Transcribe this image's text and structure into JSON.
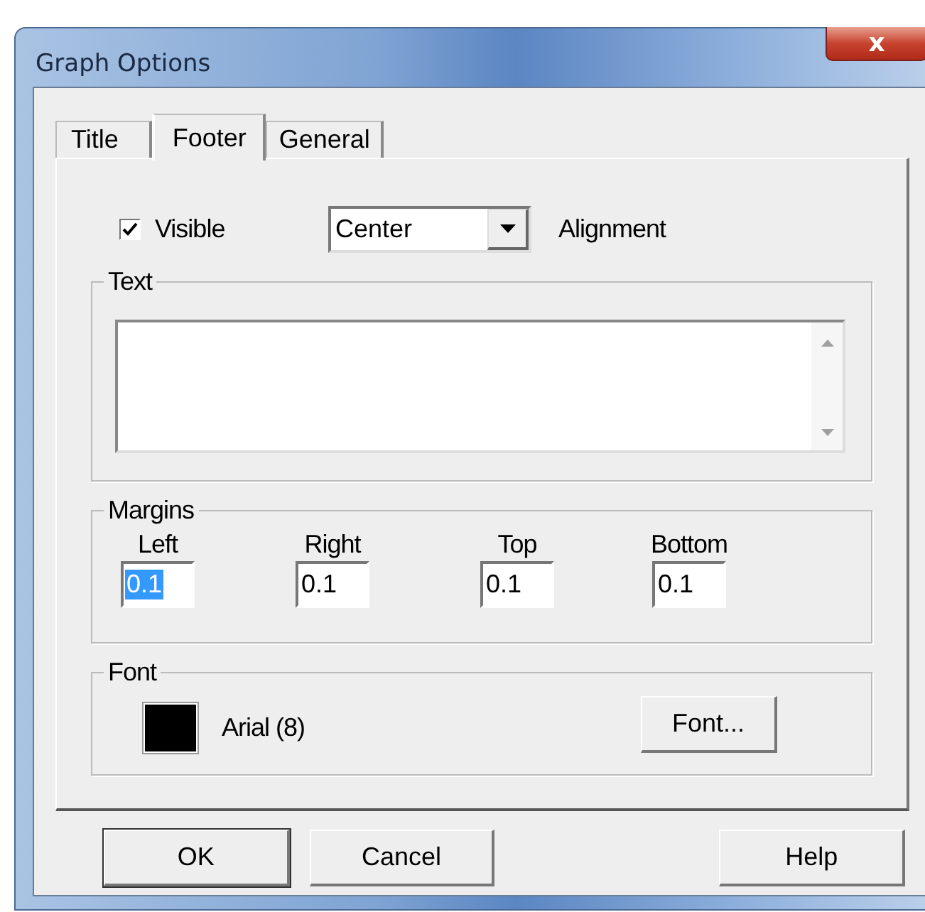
{
  "window": {
    "title": "Graph Options",
    "close": "x"
  },
  "tabs": [
    {
      "label": "Title",
      "selected": false
    },
    {
      "label": "Footer",
      "selected": true
    },
    {
      "label": "General",
      "selected": false
    }
  ],
  "visible": {
    "label": "Visible",
    "checked": true
  },
  "alignment": {
    "value": "Center",
    "label": "Alignment"
  },
  "text_group": {
    "title": "Text"
  },
  "margins": {
    "title": "Margins",
    "fields": [
      {
        "label": "Left",
        "value": "0.1",
        "selected": true
      },
      {
        "label": "Right",
        "value": "0.1",
        "selected": false
      },
      {
        "label": "Top",
        "value": "0.1",
        "selected": false
      },
      {
        "label": "Bottom",
        "value": "0.1",
        "selected": false
      }
    ]
  },
  "font": {
    "title": "Font",
    "color": "#000000",
    "description": "Arial (8)",
    "button": "Font..."
  },
  "buttons": [
    {
      "label": "OK",
      "default": true
    },
    {
      "label": "Cancel",
      "default": false
    },
    {
      "label": "Help",
      "default": false
    }
  ]
}
